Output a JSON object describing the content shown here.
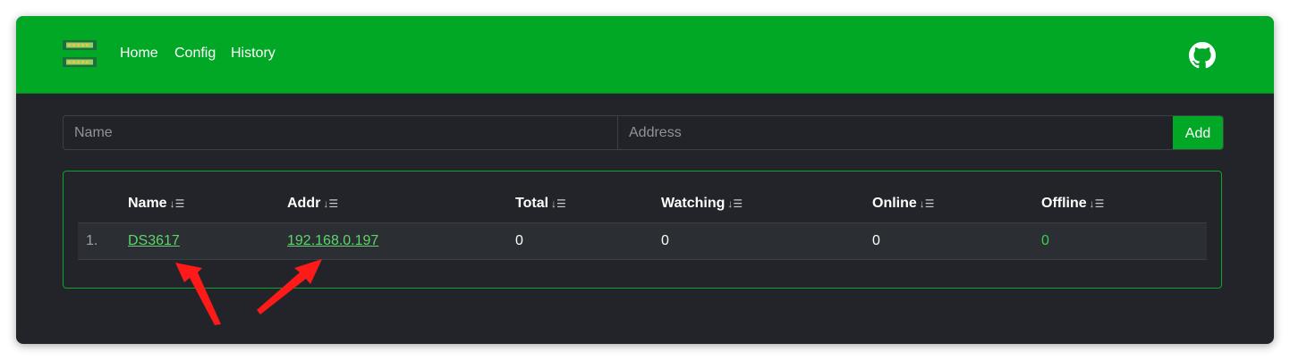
{
  "navbar": {
    "logo_icon": "memory-module-icon",
    "links": [
      "Home",
      "Config",
      "History"
    ],
    "github_icon": "github-icon"
  },
  "form": {
    "name_placeholder": "Name",
    "address_placeholder": "Address",
    "add_label": "Add"
  },
  "table": {
    "columns": [
      "Name",
      "Addr",
      "Total",
      "Watching",
      "Online",
      "Offline"
    ],
    "sort_icon": "↓☰",
    "rows": [
      {
        "index": "1.",
        "name": "DS3617",
        "addr": "192.168.0.197",
        "total": "0",
        "watching": "0",
        "online": "0",
        "offline": "0"
      }
    ]
  },
  "colors": {
    "brand_green": "#00a826",
    "background": "#222429",
    "link_green": "#5fd46c",
    "annotation_red": "#ff1a1a"
  }
}
